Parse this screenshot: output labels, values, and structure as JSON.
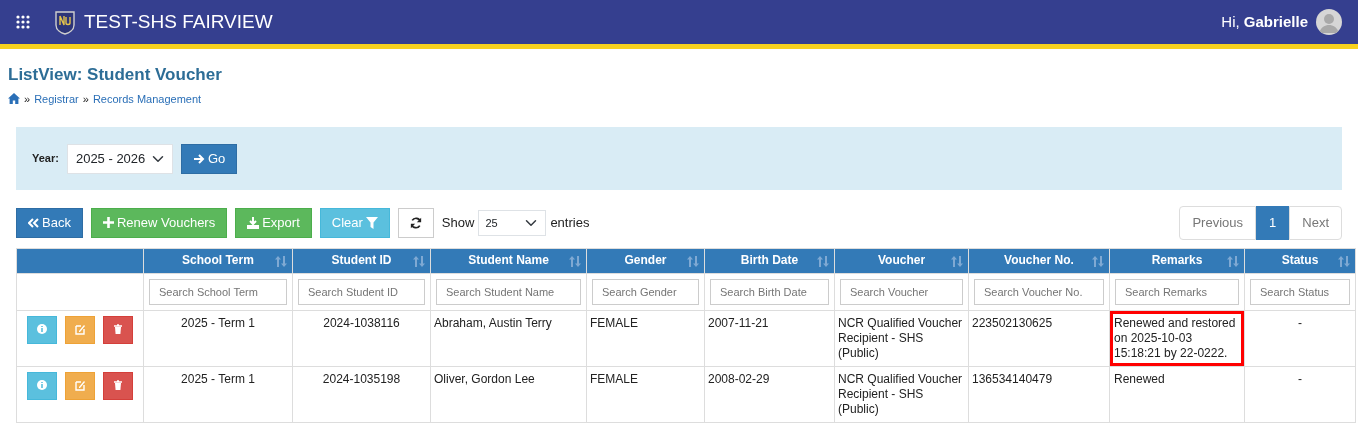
{
  "navbar": {
    "app_title": "TEST-SHS FAIRVIEW",
    "greeting": "Hi,",
    "user_name": "Gabrielle"
  },
  "page": {
    "title": "ListView: Student Voucher",
    "separator": "»",
    "breadcrumb": [
      "Registrar",
      "Records Management"
    ]
  },
  "filter": {
    "label": "Year:",
    "year_value": "2025 - 2026",
    "go_button": "Go"
  },
  "toolbar": [
    {
      "kind": "back",
      "label": "Back"
    },
    {
      "kind": "renew",
      "label": "Renew Vouchers"
    },
    {
      "kind": "export",
      "label": "Export"
    },
    {
      "kind": "clear",
      "label": "Clear"
    },
    {
      "kind": "refresh"
    }
  ],
  "length": {
    "show": "Show",
    "value": "25",
    "entries": "entries"
  },
  "pagination": [
    {
      "label": "Previous",
      "selected": false
    },
    {
      "label": "1",
      "selected": true
    },
    {
      "label": "Next",
      "selected": false
    }
  ],
  "table": {
    "columns": [
      {
        "label": "School Term",
        "placeholder": "Search School Term"
      },
      {
        "label": "Student ID",
        "placeholder": "Search Student ID"
      },
      {
        "label": "Student Name",
        "placeholder": "Search Student Name"
      },
      {
        "label": "Gender",
        "placeholder": "Search Gender"
      },
      {
        "label": "Birth Date",
        "placeholder": "Search Birth Date"
      },
      {
        "label": "Voucher",
        "placeholder": "Search Voucher"
      },
      {
        "label": "Voucher No.",
        "placeholder": "Search Voucher No."
      },
      {
        "label": "Remarks",
        "placeholder": "Search Remarks"
      },
      {
        "label": "Status",
        "placeholder": "Search Status"
      }
    ],
    "row_actions": [
      {
        "kind": "info"
      },
      {
        "kind": "edit"
      },
      {
        "kind": "delete"
      }
    ],
    "rows": [
      {
        "cells": [
          "2025 - Term 1",
          "2024-1038116",
          "Abraham, Austin Terry",
          "FEMALE",
          "2007-11-21",
          "NCR Qualified Voucher Recipient - SHS (Public)",
          "223502130625",
          "Renewed and restored on 2025-10-03 15:18:21 by 22-0222.",
          "-"
        ],
        "remarks_highlighted": true
      },
      {
        "cells": [
          "2025 - Term 1",
          "2024-1035198",
          "Oliver, Gordon Lee",
          "FEMALE",
          "2008-02-29",
          "NCR Qualified Voucher Recipient - SHS (Public)",
          "136534140479",
          "Renewed",
          "-"
        ],
        "remarks_highlighted": false
      }
    ]
  }
}
